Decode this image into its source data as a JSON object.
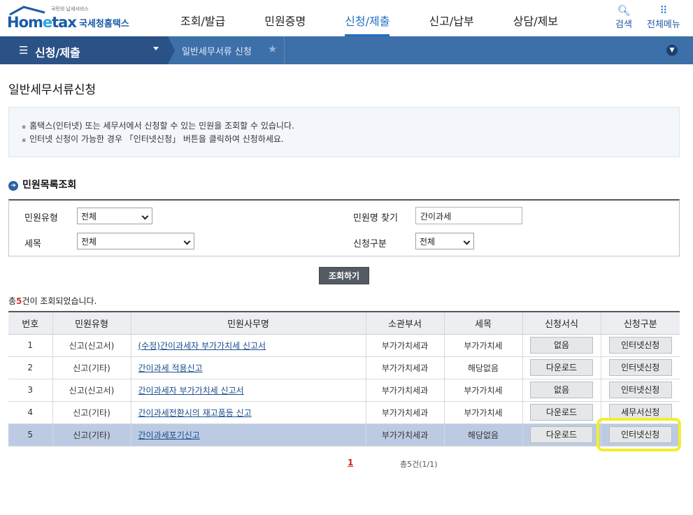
{
  "header": {
    "logo_text_home": "Hom",
    "logo_text_e": "e",
    "logo_text_tax": "tax",
    "logo_tagline": "국민의 납세서비스",
    "logo_name": "국세청홈택스",
    "nav": [
      "조회/발급",
      "민원증명",
      "신청/제출",
      "신고/납부",
      "상담/제보"
    ],
    "active_nav": "신청/제출",
    "search_label": "검색",
    "all_menu_label": "전체메뉴"
  },
  "location": {
    "main": "신청/제출",
    "sub": "일반세무서류 신청"
  },
  "page_title": "일반세무서류신청",
  "info": [
    "홈택스(인터넷) 또는 세무서에서 신청할 수 있는 민원을 조회할 수 있습니다.",
    "인터넷 신청이 가능한 경우 「인터넷신청」 버튼을 클릭하여 신청하세요."
  ],
  "section_title": "민원목록조회",
  "search": {
    "type_label": "민원유형",
    "type_value": "전체",
    "tax_label": "세목",
    "tax_value": "전체",
    "name_label": "민원명 찾기",
    "name_value": "간이과세",
    "apply_label": "신청구분",
    "apply_value": "전체",
    "button": "조회하기"
  },
  "result_count_prefix": "총",
  "result_count": "5",
  "result_count_suffix": "건이 조회되었습니다.",
  "table": {
    "headers": [
      "번호",
      "민원유형",
      "민원사무명",
      "소관부서",
      "세목",
      "신청서식",
      "신청구분"
    ],
    "rows": [
      {
        "no": "1",
        "type": "신고(신고서)",
        "name": "(수정)간이과세자 부가가치세 신고서",
        "dept": "부가가치세과",
        "tax": "부가가치세",
        "form": "없음",
        "apply": "인터넷신청"
      },
      {
        "no": "2",
        "type": "신고(기타)",
        "name": "간이과세 적용신고",
        "dept": "부가가치세과",
        "tax": "해당없음",
        "form": "다운로드",
        "apply": "인터넷신청"
      },
      {
        "no": "3",
        "type": "신고(신고서)",
        "name": "간이과세자 부가가치세 신고서",
        "dept": "부가가치세과",
        "tax": "부가가치세",
        "form": "없음",
        "apply": "인터넷신청"
      },
      {
        "no": "4",
        "type": "신고(기타)",
        "name": "간이과세전환시의 재고품등 신고",
        "dept": "부가가치세과",
        "tax": "부가가치세",
        "form": "다운로드",
        "apply": "세무서신청"
      },
      {
        "no": "5",
        "type": "신고(기타)",
        "name": "간이과세포기신고",
        "dept": "부가가치세과",
        "tax": "해당없음",
        "form": "다운로드",
        "apply": "인터넷신청"
      }
    ]
  },
  "pagination": {
    "current": "1",
    "total_text": "총5건(1/1)"
  },
  "colors": {
    "brand_blue": "#1a5aa8",
    "location_bar": "#3d6fa9",
    "selected_row": "#bccbe3",
    "highlight": "#f3ef2a"
  }
}
